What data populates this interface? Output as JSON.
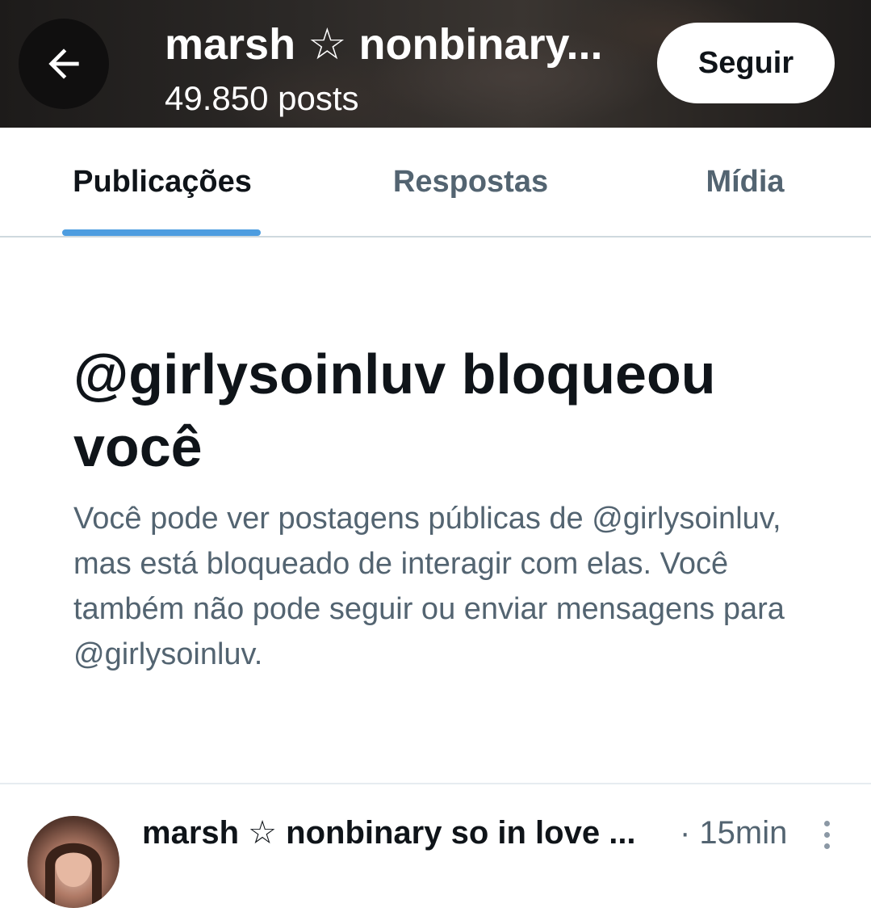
{
  "header": {
    "title": "marsh ☆ nonbinary...",
    "posts_count": "49.850 posts",
    "follow_label": "Seguir"
  },
  "tabs": [
    {
      "label": "Publicações",
      "active": true
    },
    {
      "label": "Respostas",
      "active": false
    },
    {
      "label": "Mídia",
      "active": false
    }
  ],
  "blocked": {
    "title": "@girlysoinluv bloqueou você",
    "description": "Você pode ver postagens públicas de @girlysoinluv, mas está bloqueado de interagir com elas. Você também não pode seguir ou enviar mensagens para @girlysoinluv."
  },
  "post": {
    "author": "marsh ☆ nonbinary so in love ...",
    "time": "· 15min"
  },
  "colors": {
    "accent": "#4d9de0",
    "text_primary": "#0f1419",
    "text_secondary": "#536471"
  },
  "icons": {
    "back": "arrow-left-icon",
    "more": "more-vertical-icon"
  }
}
